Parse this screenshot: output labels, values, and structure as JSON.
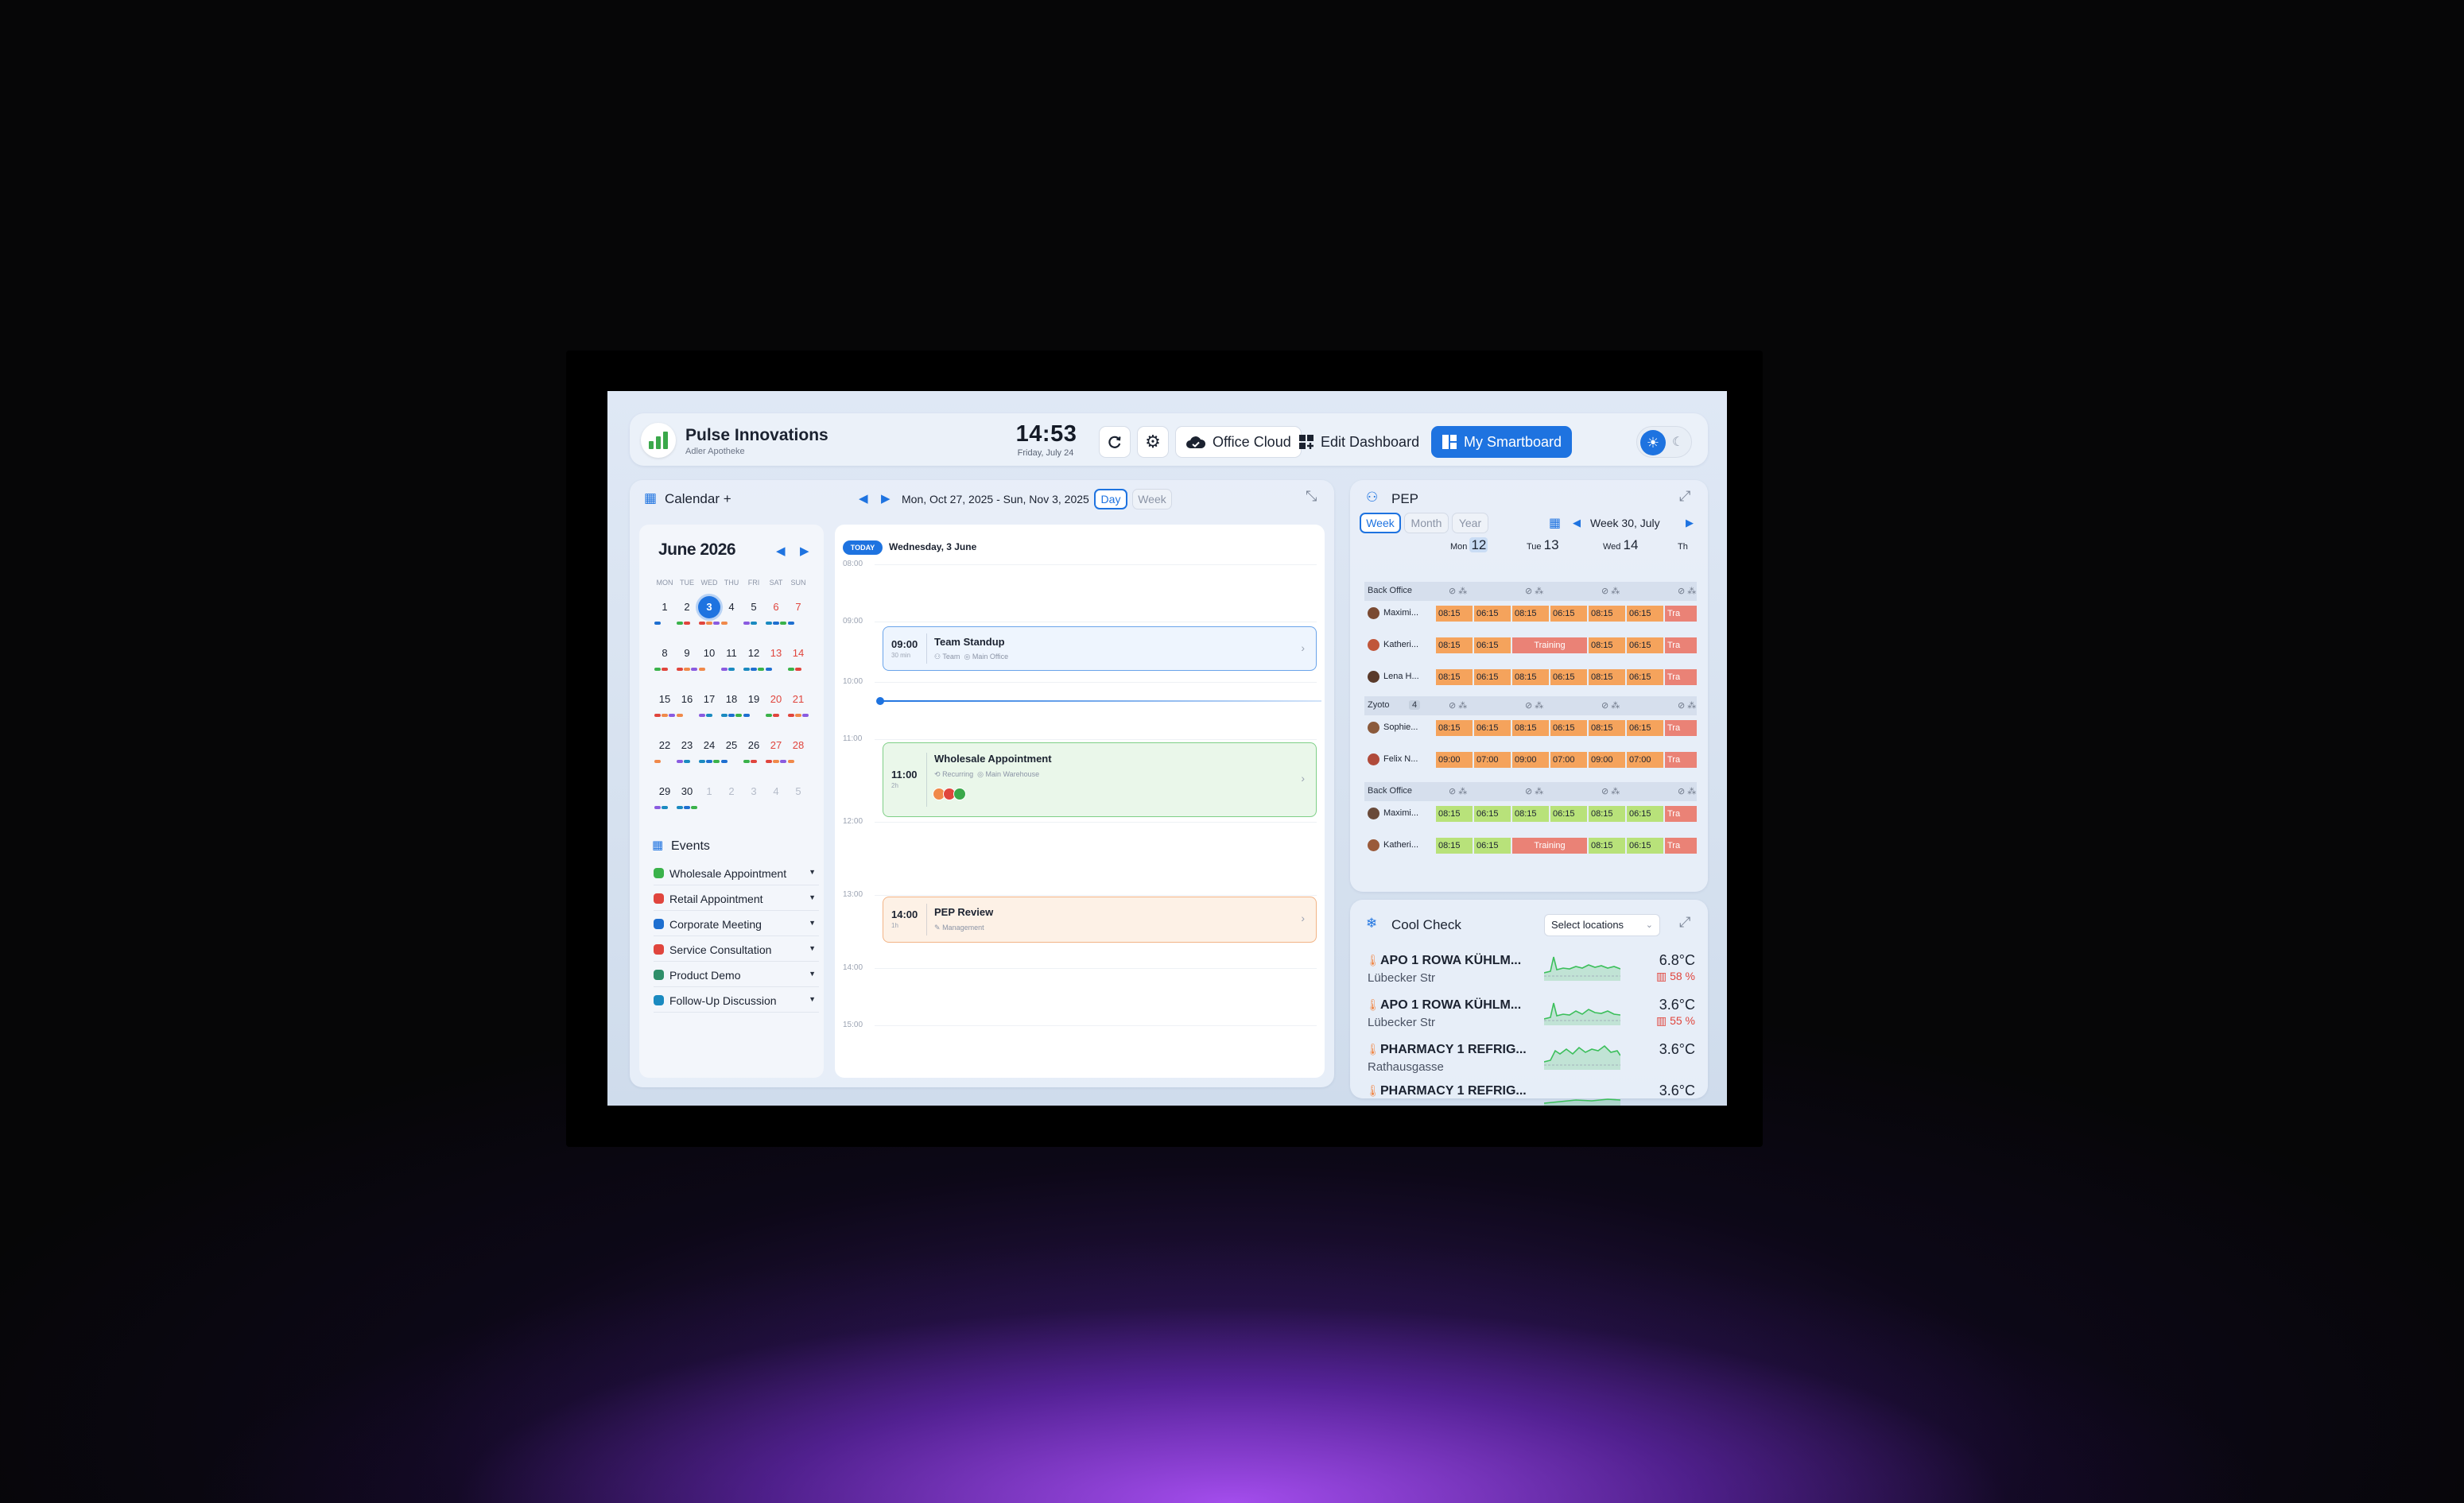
{
  "header": {
    "brand_name": "Pulse Innovations",
    "brand_sub": "Adler Apotheke",
    "clock_time": "14:53",
    "clock_date": "Friday, July 24",
    "buttons": {
      "office_cloud": "Office Cloud",
      "edit_dashboard": "Edit Dashboard",
      "my_smartboard": "My Smartboard"
    }
  },
  "calendar": {
    "title": "Calendar +",
    "date_range": "Mon, Oct 27, 2025 - Sun, Nov 3, 2025",
    "view_day": "Day",
    "view_week": "Week",
    "mini": {
      "month_title": "June 2026",
      "dow": [
        "MON",
        "TUE",
        "WED",
        "THU",
        "FRI",
        "SAT",
        "SUN"
      ],
      "weeks": [
        [
          "1",
          "2",
          "3",
          "4",
          "5",
          "6",
          "7"
        ],
        [
          "8",
          "9",
          "10",
          "11",
          "12",
          "13",
          "14"
        ],
        [
          "15",
          "16",
          "17",
          "18",
          "19",
          "20",
          "21"
        ],
        [
          "22",
          "23",
          "24",
          "25",
          "26",
          "27",
          "28"
        ],
        [
          "29",
          "30",
          "1",
          "2",
          "3",
          "4",
          "5"
        ]
      ],
      "today": "3"
    },
    "events_title": "Events",
    "event_types": [
      {
        "label": "Wholesale Appointment",
        "color": "#3ab24a"
      },
      {
        "label": "Retail Appointment",
        "color": "#e0453d"
      },
      {
        "label": "Corporate Meeting",
        "color": "#1e6fd0"
      },
      {
        "label": "Service Consultation",
        "color": "#e0453d"
      },
      {
        "label": "Product Demo",
        "color": "#2f8f6a"
      },
      {
        "label": "Follow-Up Discussion",
        "color": "#1a8ac0"
      }
    ],
    "day_view": {
      "today_label": "TODAY",
      "date": "Wednesday, 3 June",
      "hours": [
        "08:00",
        "09:00",
        "10:00",
        "11:00",
        "12:00",
        "13:00",
        "14:00",
        "15:00"
      ],
      "events": [
        {
          "time": "09:00",
          "duration": "30 min",
          "title": "Team Standup",
          "meta1": "Team",
          "meta2": "Main Office"
        },
        {
          "time": "11:00",
          "duration": "2h",
          "title": "Wholesale Appointment",
          "meta1": "Recurring",
          "meta2": "Main Warehouse"
        },
        {
          "time": "14:00",
          "duration": "1h",
          "title": "PEP Review",
          "meta1": "Management",
          "meta2": ""
        }
      ]
    }
  },
  "pep": {
    "title": "PEP",
    "tabs": [
      "Week",
      "Month",
      "Year"
    ],
    "week_label": "Week 30, July",
    "days": [
      {
        "dow": "Mon",
        "num": "12"
      },
      {
        "dow": "Tue",
        "num": "13"
      },
      {
        "dow": "Wed",
        "num": "14"
      },
      {
        "dow": "Th",
        "num": ""
      }
    ],
    "groups": [
      "Back Office",
      "Zyoto",
      "Back Office"
    ],
    "zyoto_count": "4",
    "people": [
      "Maximi...",
      "Katheri...",
      "Lena H...",
      "Sophie...",
      "Felix N...",
      "Maximi...",
      "Katheri..."
    ],
    "shift_time": "08:15",
    "end_time": "06:15",
    "alt_start": "09:00",
    "alt_end": "07:00",
    "training": "Training",
    "trunc_training": "Tra"
  },
  "cool_check": {
    "title": "Cool Check",
    "select_placeholder": "Select locations",
    "rows": [
      {
        "name": "APO 1 ROWA KÜHLM...",
        "location": "Lübecker Str",
        "temp": "6.8°C",
        "humidity": "58 %"
      },
      {
        "name": "APO 1 ROWA KÜHLM...",
        "location": "Lübecker Str",
        "temp": "3.6°C",
        "humidity": "55 %"
      },
      {
        "name": "PHARMACY 1 REFRIG...",
        "location": "Rathausgasse",
        "temp": "3.6°C",
        "humidity": ""
      },
      {
        "name": "PHARMACY 1 REFRIG...",
        "location": "",
        "temp": "3.6°C",
        "humidity": ""
      }
    ]
  },
  "colors": {
    "accent": "#1e73e0",
    "shift_orange": "#f5a35c",
    "shift_green": "#b8e27a",
    "training_red": "#ea8276",
    "chart_green": "#3bbf5a",
    "weekend_red": "#e0453d"
  }
}
